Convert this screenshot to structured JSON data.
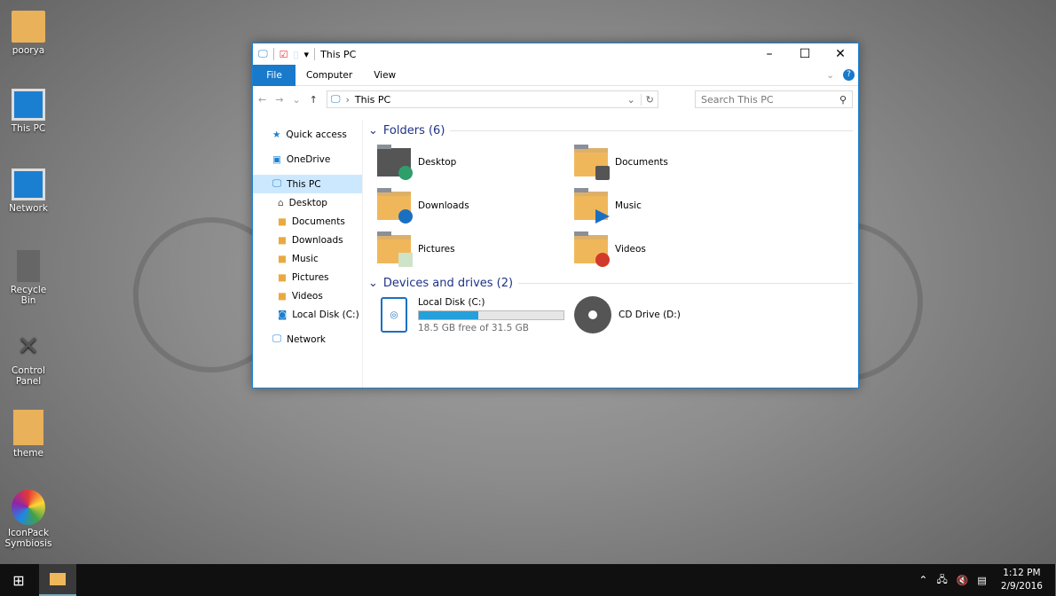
{
  "desktop": {
    "icons": [
      "poorya",
      "This PC",
      "Network",
      "Recycle Bin",
      "Control Panel",
      "theme",
      "IconPack Symbiosis"
    ]
  },
  "window": {
    "title": "This PC",
    "tabs": [
      "File",
      "Computer",
      "View"
    ],
    "address": "This PC",
    "search_placeholder": "Search This PC",
    "nav": [
      {
        "label": "Quick access"
      },
      {
        "label": "OneDrive"
      },
      {
        "label": "This PC"
      },
      {
        "label": "Desktop"
      },
      {
        "label": "Documents"
      },
      {
        "label": "Downloads"
      },
      {
        "label": "Music"
      },
      {
        "label": "Pictures"
      },
      {
        "label": "Videos"
      },
      {
        "label": "Local Disk (C:)"
      },
      {
        "label": "Network"
      }
    ],
    "folders_header": "Folders (6)",
    "folders": [
      "Desktop",
      "Documents",
      "Downloads",
      "Music",
      "Pictures",
      "Videos"
    ],
    "drives_header": "Devices and drives (2)",
    "drives": [
      {
        "name": "Local Disk (C:)",
        "free": "18.5 GB free of 31.5 GB",
        "used_fraction": 0.41
      },
      {
        "name": "CD Drive (D:)"
      }
    ]
  },
  "taskbar": {
    "time": "1:12 PM",
    "date": "2/9/2016"
  },
  "colors": {
    "accent": "#1979ca",
    "folder": "#f0b75a"
  }
}
